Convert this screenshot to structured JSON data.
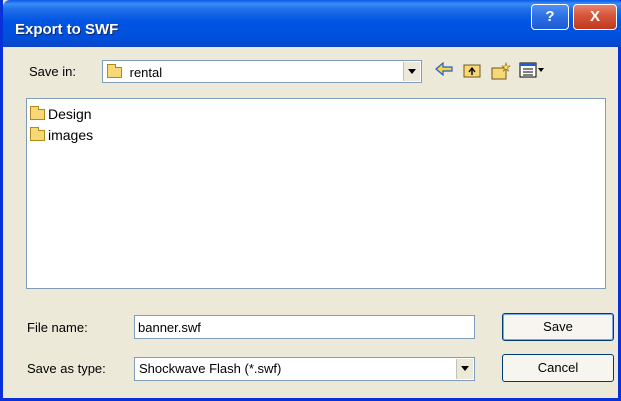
{
  "dialog": {
    "title": "Export to SWF",
    "help_glyph": "?",
    "close_glyph": "X"
  },
  "save_in": {
    "label": "Save in:",
    "value": "rental"
  },
  "toolbar": {
    "back_icon": "back-arrow-icon",
    "up_icon": "up-folder-icon",
    "new_folder_icon": "new-folder-icon",
    "views_icon": "views-menu-icon"
  },
  "files": [
    {
      "name": "Design",
      "icon": "folder-icon"
    },
    {
      "name": "images",
      "icon": "folder-icon"
    }
  ],
  "file_name": {
    "label": "File name:",
    "value": "banner.swf"
  },
  "save_as_type": {
    "label": "Save as type:",
    "value": "Shockwave Flash (*.swf)"
  },
  "buttons": {
    "save": "Save",
    "cancel": "Cancel"
  },
  "colors": {
    "titlebar": "#0054e3",
    "dialog_bg": "#ece9d8",
    "border": "#7f9db9",
    "close_button": "#d5553a"
  }
}
